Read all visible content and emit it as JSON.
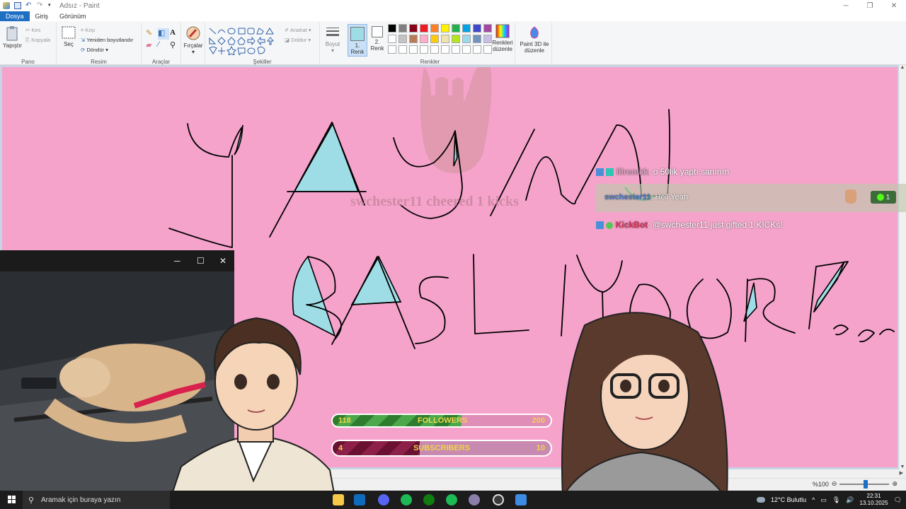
{
  "titlebar": {
    "title": "Adsız - Paint"
  },
  "tabs": [
    {
      "label": "Dosya",
      "active": true
    },
    {
      "label": "Giriş"
    },
    {
      "label": "Görünüm"
    }
  ],
  "ribbon": {
    "pano": {
      "paste": "Yapıştır",
      "cut": "Kes",
      "copy": "Kopyala",
      "label": "Pano"
    },
    "resim": {
      "select": "Seç",
      "crop": "Kırp",
      "resize": "Yeniden boyutlandır",
      "rotate": "Döndür",
      "label": "Resim"
    },
    "araclar": {
      "label": "Araçlar"
    },
    "brushes": {
      "label": "Fırçalar"
    },
    "sekiller": {
      "outline": "Anahat",
      "fill": "Doldur",
      "label": "Şekiller"
    },
    "size": {
      "label": "Boyut"
    },
    "color1": {
      "label": "1. Renk"
    },
    "color2": {
      "label": "2. Renk"
    },
    "renkler": {
      "label": "Renkler"
    },
    "edit_colors": {
      "label": "Renkleri düzenle"
    },
    "paint3d": {
      "label": "Paint 3D ile düzenle"
    },
    "palette": [
      "#000000",
      "#7f7f7f",
      "#880015",
      "#ed1c24",
      "#ff7f27",
      "#fff200",
      "#22b14c",
      "#00a2e8",
      "#3f48cc",
      "#a349a4",
      "#ffffff",
      "#c3c3c3",
      "#b97a57",
      "#ffaec9",
      "#ffc90e",
      "#efe4b0",
      "#b5e61d",
      "#99d9ea",
      "#7092be",
      "#c8bfe7",
      "#ffffff",
      "#ffffff",
      "#ffffff",
      "#ffffff",
      "#ffffff",
      "#ffffff",
      "#ffffff",
      "#ffffff",
      "#ffffff",
      "#ffffff"
    ]
  },
  "overlay": {
    "alert": "swchester11 cheered 1 kicks",
    "chat": [
      {
        "user": "lilremkk",
        "message": ": o 50lik yaptı sanırım"
      },
      {
        "user": "swchester11",
        "message": ": Hell Yeah",
        "badge": "1"
      },
      {
        "user": "KickBot",
        "message": ": @swchester11 just gifted 1 KICKs!"
      }
    ],
    "followers": {
      "current": "118",
      "label": "FOLLOWERS",
      "goal": "200",
      "fraction": 0.59
    },
    "subscribers": {
      "current": "4",
      "label": "SUBSCRIBERS",
      "goal": "10",
      "fraction": 0.4
    }
  },
  "statusbar": {
    "zoom": "%100"
  },
  "taskbar": {
    "search_placeholder": "Aramak için buraya yazın",
    "weather": "12°C  Bulutlu",
    "time": "22:31",
    "date": "13.10.2025"
  },
  "colors": {
    "canvas": "#f5a3cb",
    "accent": "#1e6fc4",
    "fill_cyan": "#9fdde6"
  }
}
